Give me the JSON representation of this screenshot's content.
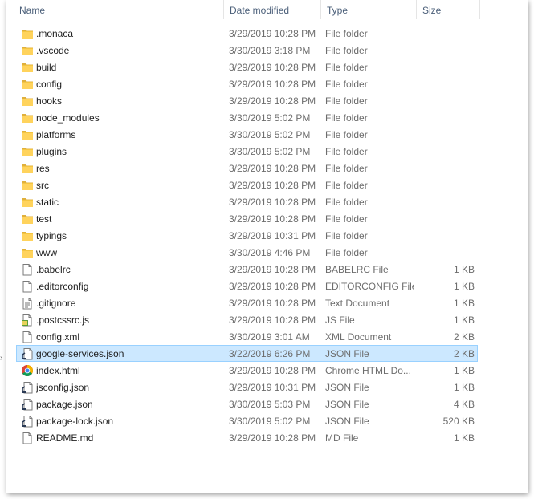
{
  "columns": {
    "name": "Name",
    "date": "Date modified",
    "type": "Type",
    "size": "Size"
  },
  "files": [
    {
      "name": ".monaca",
      "date": "3/29/2019 10:28 PM",
      "type": "File folder",
      "size": "",
      "icon": "folder-icon"
    },
    {
      "name": ".vscode",
      "date": "3/30/2019 3:18 PM",
      "type": "File folder",
      "size": "",
      "icon": "folder-icon"
    },
    {
      "name": "build",
      "date": "3/29/2019 10:28 PM",
      "type": "File folder",
      "size": "",
      "icon": "folder-icon"
    },
    {
      "name": "config",
      "date": "3/29/2019 10:28 PM",
      "type": "File folder",
      "size": "",
      "icon": "folder-icon"
    },
    {
      "name": "hooks",
      "date": "3/29/2019 10:28 PM",
      "type": "File folder",
      "size": "",
      "icon": "folder-icon"
    },
    {
      "name": "node_modules",
      "date": "3/30/2019 5:02 PM",
      "type": "File folder",
      "size": "",
      "icon": "folder-icon"
    },
    {
      "name": "platforms",
      "date": "3/30/2019 5:02 PM",
      "type": "File folder",
      "size": "",
      "icon": "folder-icon"
    },
    {
      "name": "plugins",
      "date": "3/30/2019 5:02 PM",
      "type": "File folder",
      "size": "",
      "icon": "folder-icon"
    },
    {
      "name": "res",
      "date": "3/29/2019 10:28 PM",
      "type": "File folder",
      "size": "",
      "icon": "folder-icon"
    },
    {
      "name": "src",
      "date": "3/29/2019 10:28 PM",
      "type": "File folder",
      "size": "",
      "icon": "folder-icon"
    },
    {
      "name": "static",
      "date": "3/29/2019 10:28 PM",
      "type": "File folder",
      "size": "",
      "icon": "folder-icon"
    },
    {
      "name": "test",
      "date": "3/29/2019 10:28 PM",
      "type": "File folder",
      "size": "",
      "icon": "folder-icon"
    },
    {
      "name": "typings",
      "date": "3/29/2019 10:31 PM",
      "type": "File folder",
      "size": "",
      "icon": "folder-icon"
    },
    {
      "name": "www",
      "date": "3/30/2019 4:46 PM",
      "type": "File folder",
      "size": "",
      "icon": "folder-icon"
    },
    {
      "name": ".babelrc",
      "date": "3/29/2019 10:28 PM",
      "type": "BABELRC File",
      "size": "1 KB",
      "icon": "blank-file-icon"
    },
    {
      "name": ".editorconfig",
      "date": "3/29/2019 10:28 PM",
      "type": "EDITORCONFIG File",
      "size": "1 KB",
      "icon": "blank-file-icon"
    },
    {
      "name": ".gitignore",
      "date": "3/29/2019 10:28 PM",
      "type": "Text Document",
      "size": "1 KB",
      "icon": "text-file-icon"
    },
    {
      "name": ".postcssrc.js",
      "date": "3/29/2019 10:28 PM",
      "type": "JS File",
      "size": "1 KB",
      "icon": "js-file-icon"
    },
    {
      "name": "config.xml",
      "date": "3/30/2019 3:01 AM",
      "type": "XML Document",
      "size": "2 KB",
      "icon": "blank-file-icon"
    },
    {
      "name": "google-services.json",
      "date": "3/22/2019 6:26 PM",
      "type": "JSON File",
      "size": "2 KB",
      "icon": "json-file-icon",
      "selected": true
    },
    {
      "name": "index.html",
      "date": "3/29/2019 10:28 PM",
      "type": "Chrome HTML Do...",
      "size": "1 KB",
      "icon": "chrome-icon"
    },
    {
      "name": "jsconfig.json",
      "date": "3/29/2019 10:31 PM",
      "type": "JSON File",
      "size": "1 KB",
      "icon": "json-file-icon"
    },
    {
      "name": "package.json",
      "date": "3/30/2019 5:03 PM",
      "type": "JSON File",
      "size": "4 KB",
      "icon": "json-file-icon"
    },
    {
      "name": "package-lock.json",
      "date": "3/30/2019 5:02 PM",
      "type": "JSON File",
      "size": "520 KB",
      "icon": "json-file-icon"
    },
    {
      "name": "README.md",
      "date": "3/29/2019 10:28 PM",
      "type": "MD File",
      "size": "1 KB",
      "icon": "blank-file-icon"
    }
  ],
  "colors": {
    "selection_bg": "#cce8ff",
    "selection_border": "#99d1ff",
    "header_text": "#4c607a",
    "folder_yellow": "#ffd35c"
  }
}
